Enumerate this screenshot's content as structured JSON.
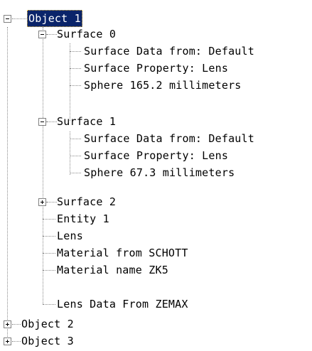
{
  "tree": {
    "object1": {
      "label": "Object 1",
      "expanded": true,
      "selected": true,
      "surface0": {
        "label": "Surface 0",
        "expanded": true,
        "items": [
          "Surface Data from: Default",
          "Surface Property: Lens",
          "Sphere 165.2 millimeters"
        ]
      },
      "surface1": {
        "label": "Surface 1",
        "expanded": true,
        "items": [
          "Surface Data from: Default",
          "Surface Property: Lens",
          "Sphere 67.3 millimeters"
        ]
      },
      "surface2": {
        "label": "Surface 2",
        "expanded": false
      },
      "leaves": [
        "Entity 1",
        "Lens",
        "Material from SCHOTT",
        "Material name ZK5",
        "Lens Data From ZEMAX"
      ]
    },
    "object2": {
      "label": "Object 2",
      "expanded": false
    },
    "object3": {
      "label": "Object 3",
      "expanded": false
    }
  }
}
